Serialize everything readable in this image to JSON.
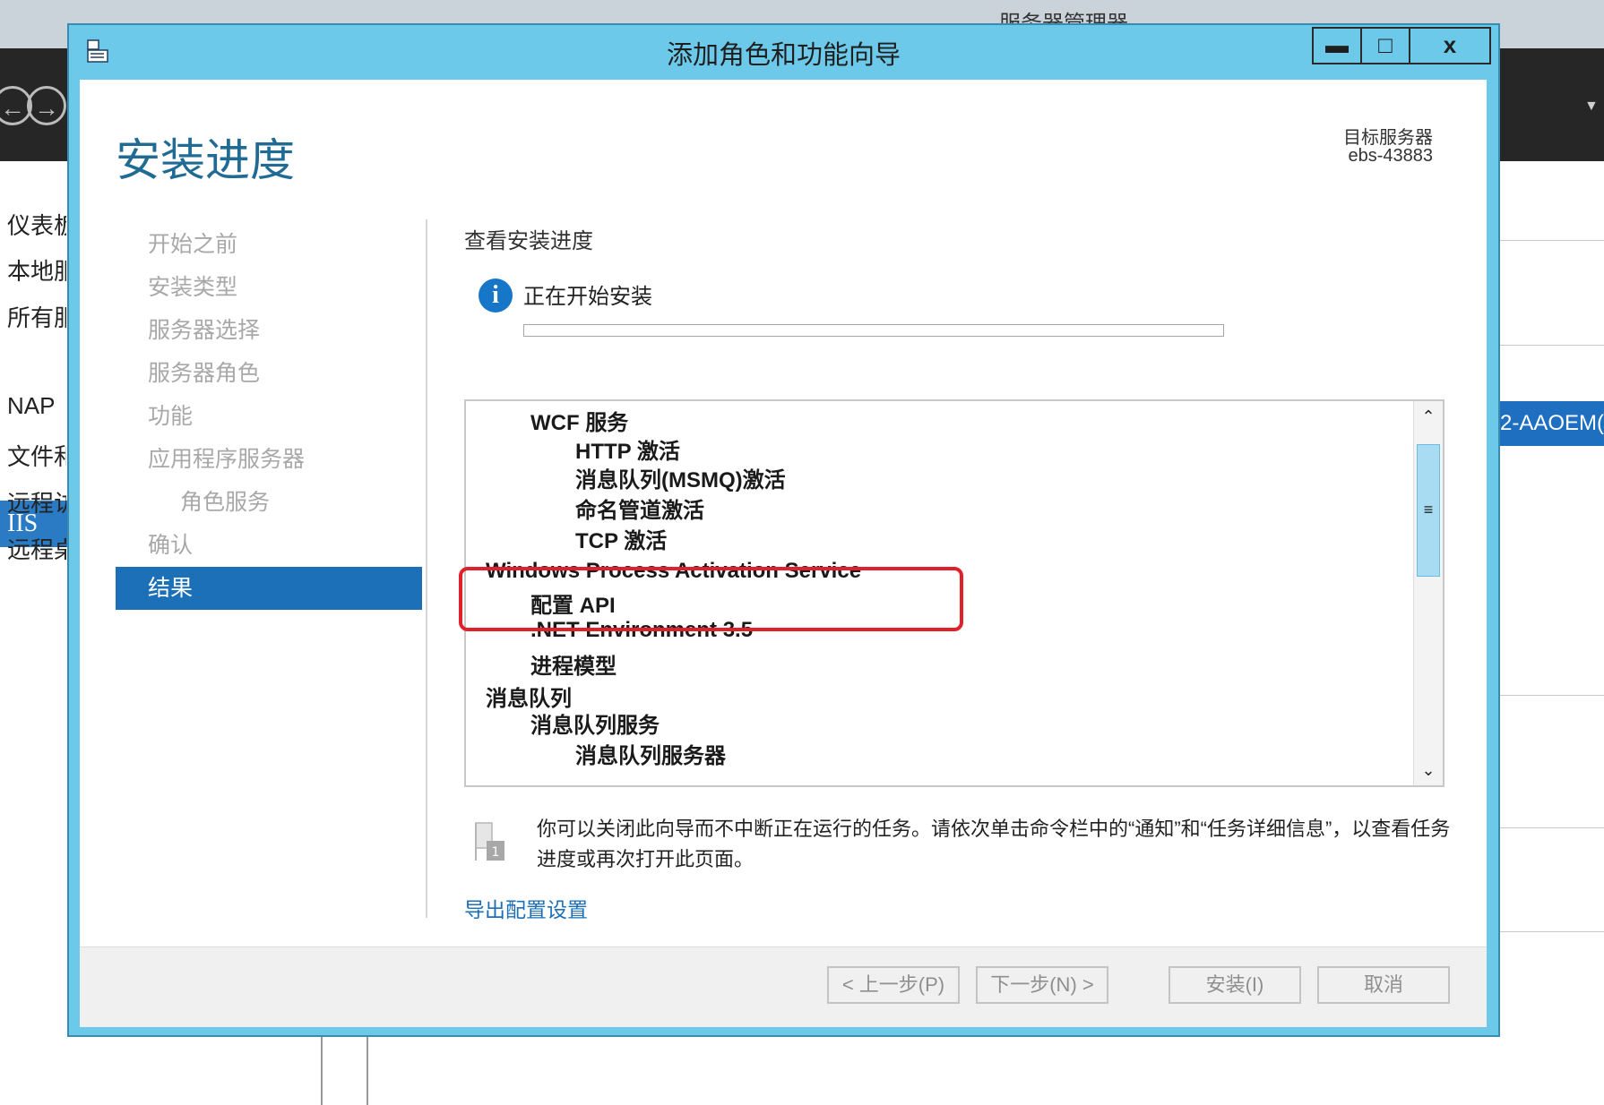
{
  "background_window": {
    "title": "服务器管理器",
    "sidebar_items": [
      "仪表板",
      "本地服务器",
      "所有服务器",
      "IIS",
      "NAP",
      "文件和存储服务",
      "远程访问",
      "远程桌面服务"
    ],
    "selected_item": "IIS",
    "highlight_row_text": "2-AAOEM("
  },
  "dialog": {
    "title": "添加角色和功能向导",
    "controls": {
      "minimize": "▬",
      "maximize": "□",
      "close": "x"
    },
    "page_title": "安装进度",
    "target_server_label": "目标服务器",
    "target_server_value": "ebs-43883",
    "steps": [
      {
        "label": "开始之前",
        "level": 0
      },
      {
        "label": "安装类型",
        "level": 0
      },
      {
        "label": "服务器选择",
        "level": 0
      },
      {
        "label": "服务器角色",
        "level": 0
      },
      {
        "label": "功能",
        "level": 0
      },
      {
        "label": "应用程序服务器",
        "level": 0
      },
      {
        "label": "角色服务",
        "level": 1
      },
      {
        "label": "确认",
        "level": 0
      },
      {
        "label": "结果",
        "level": 0,
        "active": true
      }
    ],
    "section_label": "查看安装进度",
    "status_text": "正在开始安装",
    "progress_percent": 0,
    "features": [
      {
        "label": "WCF 服务",
        "level": 1
      },
      {
        "label": "HTTP 激活",
        "level": 2
      },
      {
        "label": "消息队列(MSMQ)激活",
        "level": 2
      },
      {
        "label": "命名管道激活",
        "level": 2
      },
      {
        "label": "TCP 激活",
        "level": 2
      },
      {
        "label": "Windows Process Activation Service",
        "level": 0
      },
      {
        "label": "配置 API",
        "level": 1
      },
      {
        "label": ".NET Environment 3.5",
        "level": 1
      },
      {
        "label": "进程模型",
        "level": 1
      },
      {
        "label": "消息队列",
        "level": 0
      },
      {
        "label": "消息队列服务",
        "level": 1
      },
      {
        "label": "消息队列服务器",
        "level": 2
      }
    ],
    "notice": "你可以关闭此向导而不中断正在运行的任务。请依次单击命令栏中的“通知”和“任务详细信息”，以查看任务进度或再次打开此页面。",
    "export_link": "导出配置设置",
    "buttons": {
      "previous": "< 上一步(P)",
      "next": "下一步(N) >",
      "install": "安装(I)",
      "cancel": "取消"
    },
    "colors": {
      "frame": "#6cc9ea",
      "title_text": "#1f6b94",
      "active_step": "#1c70b8",
      "highlight_border": "#e0202a",
      "link": "#1c6fb8"
    }
  }
}
